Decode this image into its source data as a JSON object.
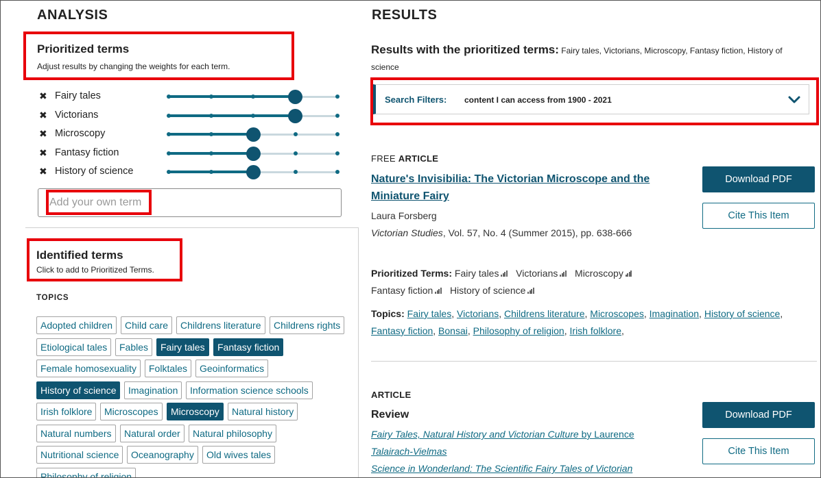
{
  "analysis": {
    "heading": "ANALYSIS",
    "prioritized": {
      "title": "Prioritized terms",
      "subtitle": "Adjust results by changing the weights for each term.",
      "remove_glyph": "✖",
      "terms": [
        {
          "label": "Fairy tales",
          "weight": 4
        },
        {
          "label": "Victorians",
          "weight": 4
        },
        {
          "label": "Microscopy",
          "weight": 3
        },
        {
          "label": "Fantasy fiction",
          "weight": 3
        },
        {
          "label": "History of science",
          "weight": 3
        }
      ],
      "weight_levels": 5,
      "add_placeholder": "Add your own term"
    },
    "identified": {
      "title": "Identified terms",
      "subtitle": "Click to add to Prioritized Terms.",
      "topics_label": "TOPICS",
      "tags": [
        {
          "label": "Adopted children",
          "selected": false
        },
        {
          "label": "Child care",
          "selected": false
        },
        {
          "label": "Childrens literature",
          "selected": false
        },
        {
          "label": "Childrens rights",
          "selected": false
        },
        {
          "label": "Etiological tales",
          "selected": false
        },
        {
          "label": "Fables",
          "selected": false
        },
        {
          "label": "Fairy tales",
          "selected": true
        },
        {
          "label": "Fantasy fiction",
          "selected": true
        },
        {
          "label": "Female homosexuality",
          "selected": false
        },
        {
          "label": "Folktales",
          "selected": false
        },
        {
          "label": "Geoinformatics",
          "selected": false
        },
        {
          "label": "History of science",
          "selected": true
        },
        {
          "label": "Imagination",
          "selected": false
        },
        {
          "label": "Information science schools",
          "selected": false
        },
        {
          "label": "Irish folklore",
          "selected": false
        },
        {
          "label": "Microscopes",
          "selected": false
        },
        {
          "label": "Microscopy",
          "selected": true
        },
        {
          "label": "Natural history",
          "selected": false
        },
        {
          "label": "Natural numbers",
          "selected": false
        },
        {
          "label": "Natural order",
          "selected": false
        },
        {
          "label": "Natural philosophy",
          "selected": false
        },
        {
          "label": "Nutritional science",
          "selected": false
        },
        {
          "label": "Oceanography",
          "selected": false
        },
        {
          "label": "Old wives tales",
          "selected": false
        },
        {
          "label": "Philosophy of religion",
          "selected": false
        }
      ]
    }
  },
  "results": {
    "heading": "RESULTS",
    "prioritized_title": "Results with the prioritized terms:",
    "prioritized_list": "Fairy tales, Victorians, Microscopy, Fantasy fiction, History of science",
    "filters": {
      "label": "Search Filters:",
      "value": "content I can access from 1900 - 2021"
    },
    "articles": [
      {
        "type_prefix": "FREE",
        "type": "ARTICLE",
        "title_line1": "Nature's Invisibilia: The Victorian Microscope and the",
        "title_line2": "Miniature Fairy",
        "author": "Laura Forsberg",
        "journal": "Victorian Studies",
        "citation": ", Vol. 57, No. 4 (Summer 2015), pp. 638-666",
        "download_label": "Download PDF",
        "cite_label": "Cite This Item",
        "prioritized_label": "Prioritized Terms:",
        "prioritized_terms": [
          "Fairy tales",
          "Victorians",
          "Microscopy",
          "Fantasy fiction",
          "History of science"
        ],
        "topics_label": "Topics:",
        "topics": [
          "Fairy tales",
          "Victorians",
          "Childrens literature",
          "Microscopes",
          "Imagination",
          "History of science",
          "Fantasy fiction",
          "Bonsai",
          "Philosophy of religion",
          "Irish folklore"
        ]
      },
      {
        "type": "ARTICLE",
        "title": "Review",
        "download_label": "Download PDF",
        "cite_label": "Cite This Item",
        "reviewed_1_title": "Fairy Tales, Natural History and Victorian Culture",
        "reviewed_1_by": " by Laurence",
        "reviewed_1_line2": "Talairach-Vielmas",
        "reviewed_2_title": "Science in Wonderland: The Scientific Fairy Tales of Victorian"
      }
    ]
  }
}
